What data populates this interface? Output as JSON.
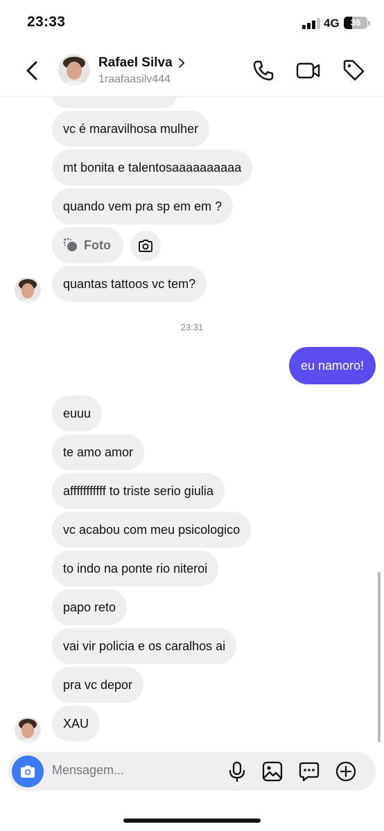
{
  "status_bar": {
    "time": "23:33",
    "network": "4G",
    "battery": "36",
    "battery_level": 0.36
  },
  "header": {
    "contact_name": "Rafael Silva",
    "username": "1raafaasilv444",
    "icons": [
      "back-icon",
      "phone-icon",
      "video-icon",
      "tag-icon"
    ]
  },
  "messages_before": [
    "vc é maravilhosa mulher",
    "mt bonita e talentosaaaaaaaaaa",
    "quando vem pra sp em em ?"
  ],
  "photo_pill": {
    "label": "Foto",
    "icon": "loading-icon"
  },
  "last_before_time": "quantas tattoos vc tem?",
  "timestamp": "23:31",
  "outgoing": "eu namoro!",
  "messages_after": [
    "euuu",
    "te amo amor",
    "afffffffffff to triste serio giulia",
    "vc acabou com meu psicologico",
    "to indo na ponte rio niteroi",
    "papo reto",
    "vai vir policia e os caralhos ai",
    "pra vc depor",
    "XAU"
  ],
  "composer": {
    "placeholder": "Mensagem...",
    "icons": [
      "camera-icon",
      "microphone-icon",
      "gallery-icon",
      "sticker-icon",
      "plus-icon"
    ]
  },
  "colors": {
    "outgoing_bubble": "#5b4cf0",
    "incoming_bubble": "#efeff1",
    "camera_button": "#3d7bf6"
  }
}
